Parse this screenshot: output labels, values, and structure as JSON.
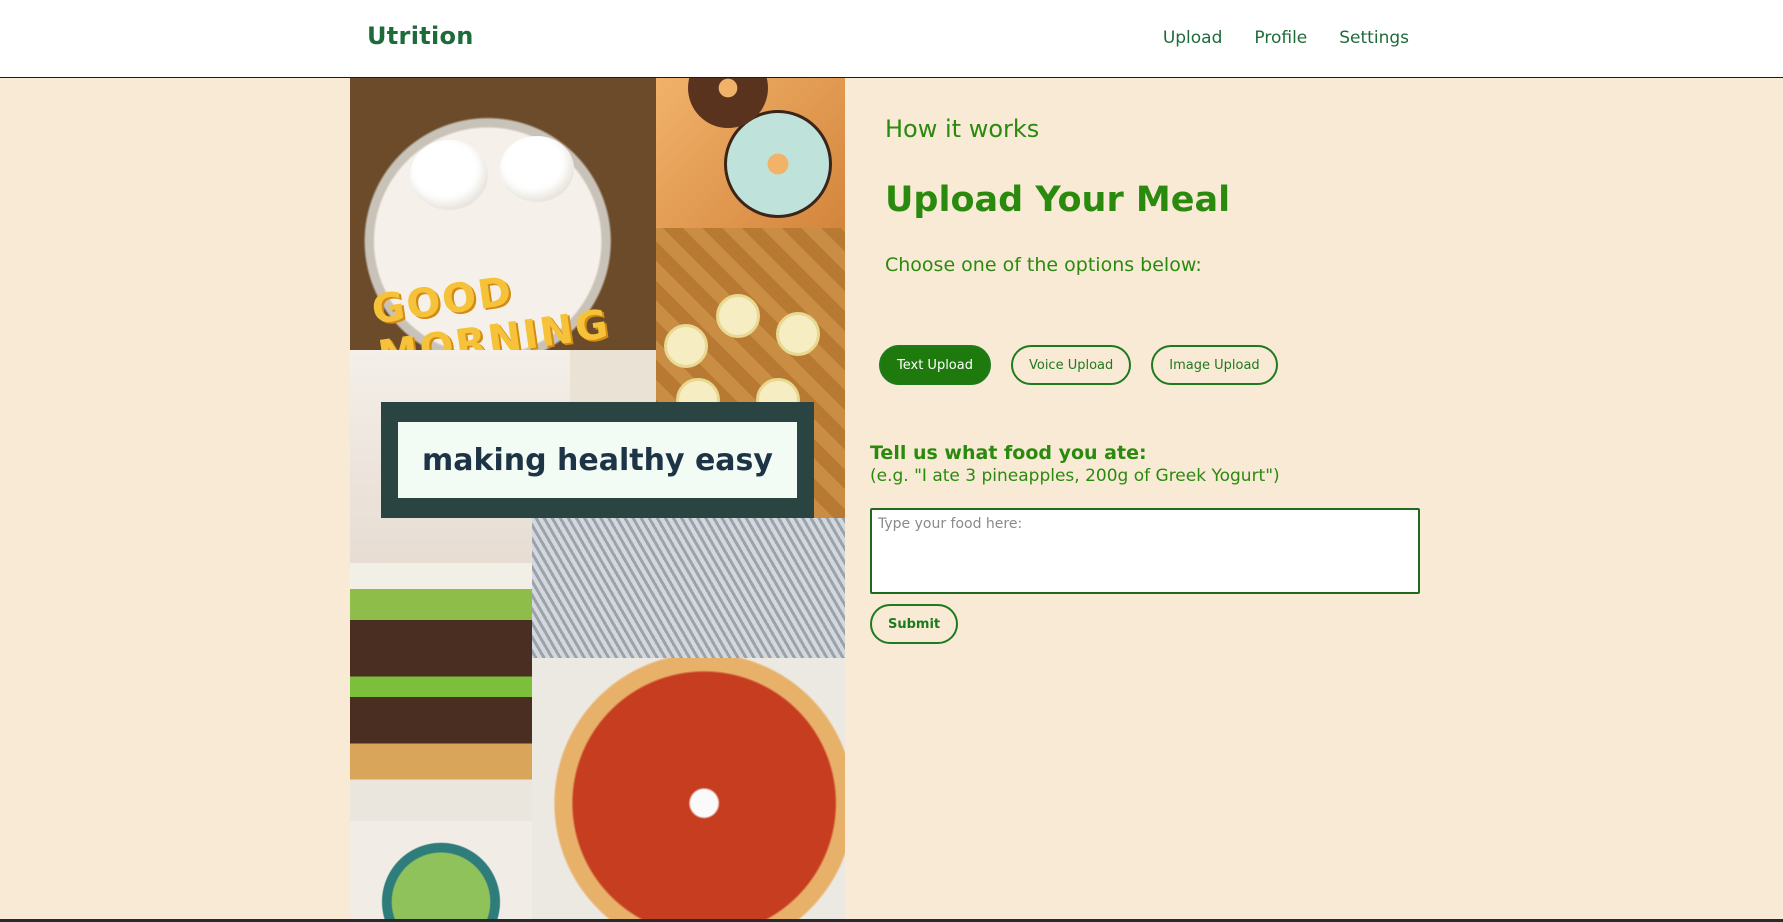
{
  "header": {
    "brand": "Utrition",
    "nav": [
      "Upload",
      "Profile",
      "Settings"
    ]
  },
  "collage": {
    "banner_text": "making healthy easy",
    "plate_lettering": "GOOD MORNING"
  },
  "main": {
    "section_label": "How it works",
    "title": "Upload Your Meal",
    "instructions": "Choose one of the options below:",
    "upload_options": [
      {
        "label": "Text Upload",
        "active": true
      },
      {
        "label": "Voice Upload",
        "active": false
      },
      {
        "label": "Image Upload",
        "active": false
      }
    ],
    "food_prompt": "Tell us what food you ate:",
    "food_example": "(e.g. \"I ate 3 pineapples, 200g of Greek Yogurt\")",
    "food_input_placeholder": "Type your food here:",
    "food_input_value": "",
    "submit_label": "Submit"
  },
  "colors": {
    "background": "#f9ead6",
    "accent": "#2a8a0e",
    "brand": "#1e6b3a",
    "banner": "#2a4541"
  }
}
